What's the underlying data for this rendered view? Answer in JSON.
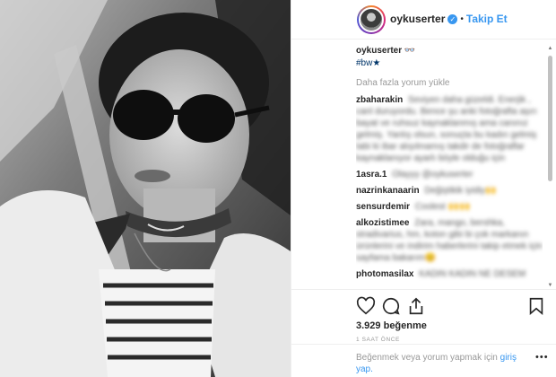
{
  "post": {
    "username": "oykuserter",
    "verified_icon": "verified-badge-icon",
    "separator": "•",
    "follow_label": "Takip Et"
  },
  "caption": {
    "user": "oykuserter",
    "text": "👓",
    "hashtag": "#bw★"
  },
  "load_more_label": "Daha fazla yorum yükle",
  "comments": [
    {
      "user": "zbaharakin",
      "text": "Seviyen daha güzeldi. Enerjik , canl"
    },
    {
      "user": "",
      "text": "duruyordu. Bence şu anki fotoğrafta aşırı bayat ve ruhsuz kaynaklanmış ama canınız gelmiş. Yanlış olsun, sonuçta bu kadın gelmiş tabi ki ibar alışılmamış takdir de fotoğraflar kaynaklanıyor ayarlı böyle olduğu için"
    },
    {
      "user": "1asra.1",
      "text": "Olayyy @oykuserter"
    },
    {
      "user": "nazrinkanaarin",
      "text": "Değiştikik iyidiy🙌"
    },
    {
      "user": "sensurdemir",
      "text": "Coolest 🙌🙌"
    },
    {
      "user": "alkozistimee",
      "text": "Zara, mango, bershka, stradivarius, hm, koton gibi bi çok markanın ürünlerini ve indirim haberlerini takip etmek için sayfama bakarım😊"
    },
    {
      "user": "photomasilax",
      "text": "KADIN KADIN NE DESEM"
    }
  ],
  "likes_count": "3.929",
  "likes_label": "beğenme",
  "time_ago": "1 SAAT ÖNCE",
  "login_prompt": "Beğenmek veya yorum yapmak için",
  "login_link": "giriş yap.",
  "more_options": "•••",
  "icons": {
    "like": "heart-icon",
    "comment": "comment-bubble-icon",
    "share": "share-icon",
    "save": "bookmark-icon"
  },
  "colors": {
    "link": "#3897f0",
    "hashtag": "#003569",
    "muted": "#999999",
    "text": "#262626",
    "border": "#efefef"
  }
}
